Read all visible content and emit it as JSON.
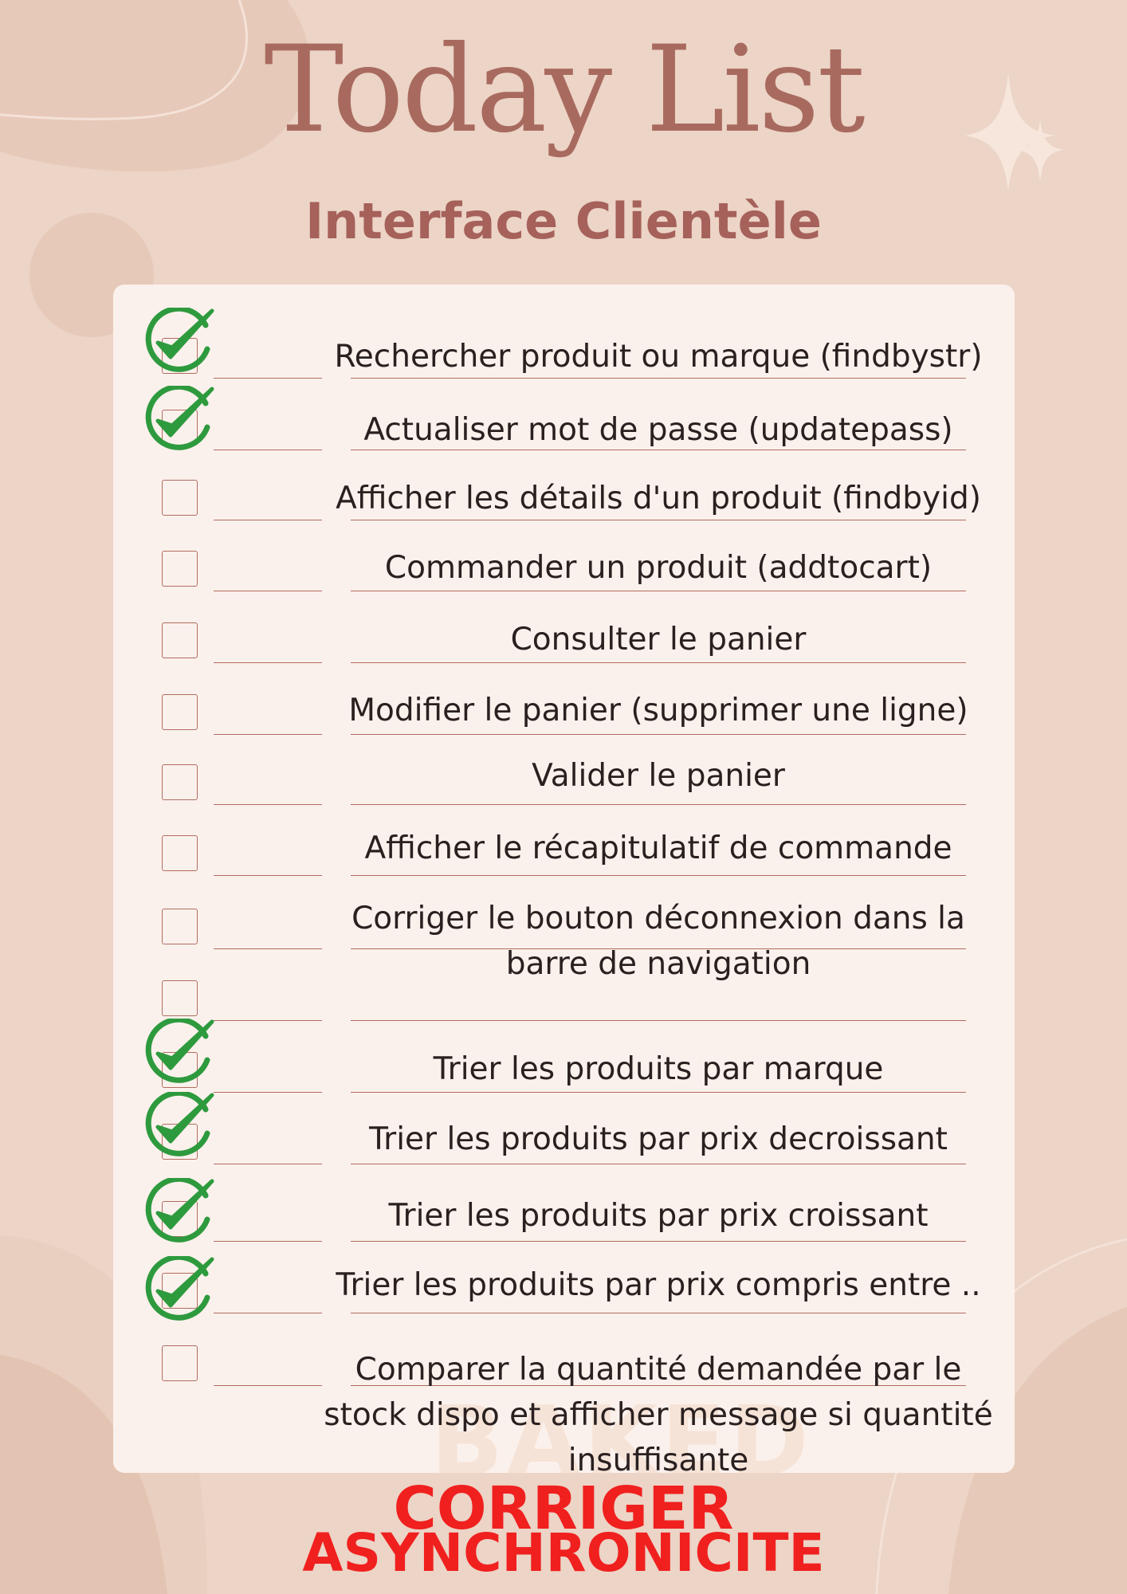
{
  "title": "Today List",
  "subtitle": "Interface Clientèle",
  "watermark": "BAKED",
  "colors": {
    "background": "#ecd4c6",
    "card": "#fbf1ec",
    "accent": "#a86a5f",
    "check": "#2e9a3e",
    "note": "#f0201f"
  },
  "items": [
    {
      "label": "Rechercher produit ou marque (findbystr)",
      "checked": true
    },
    {
      "label": "Actualiser mot de passe (updatepass)",
      "checked": true
    },
    {
      "label": "Afficher les détails d'un produit (findbyid)",
      "checked": false
    },
    {
      "label": "Commander un produit (addtocart)",
      "checked": false
    },
    {
      "label": "Consulter le panier",
      "checked": false
    },
    {
      "label": "Modifier le panier (supprimer une ligne)",
      "checked": false
    },
    {
      "label": "Valider le panier",
      "checked": false
    },
    {
      "label": "Afficher le récapitulatif de commande",
      "checked": false
    },
    {
      "label": "Corriger le bouton déconnexion dans la",
      "label2": "barre de navigation",
      "checked": false
    },
    {
      "label": "",
      "checked": false
    },
    {
      "label": "Trier les produits par marque",
      "checked": true
    },
    {
      "label": "Trier les produits par prix decroissant",
      "checked": true
    },
    {
      "label": "Trier les produits par prix croissant",
      "checked": true
    },
    {
      "label": "Trier les produits par prix compris entre ..",
      "checked": true
    },
    {
      "label": "Comparer la quantité demandée par le",
      "label2": "stock dispo et afficher message si quantité",
      "label3": "insuffisante",
      "checked": false
    }
  ],
  "note": {
    "line1": "CORRIGER",
    "line2": "ASYNCHRONICITE"
  }
}
